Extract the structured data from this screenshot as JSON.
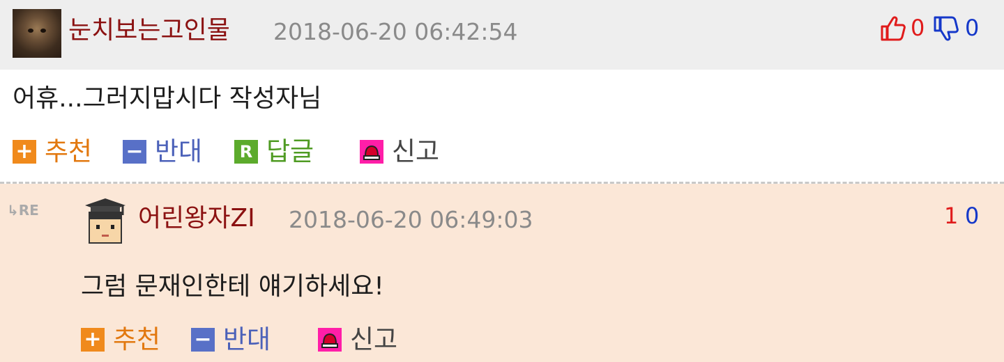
{
  "comment1": {
    "nickname": "눈치보는고인물",
    "date": "2018-06-20 06:42:54",
    "upvotes": "0",
    "downvotes": "0",
    "text": "어휴...그러지맙시다 작성자님",
    "actions": {
      "recommend": "추천",
      "oppose": "반대",
      "reply": "답글",
      "report": "신고"
    }
  },
  "comment2": {
    "reply_marker": "RE",
    "nickname": "어린왕자ZI",
    "date": "2018-06-20 06:49:03",
    "upvotes": "1",
    "downvotes": "0",
    "text": "그럼 문재인한테 얘기하세요!",
    "actions": {
      "recommend": "추천",
      "oppose": "반대",
      "report": "신고"
    }
  },
  "icons": {
    "recommend": "plus-icon",
    "oppose": "minus-icon",
    "reply": "reply-r-icon",
    "report": "siren-icon",
    "upvote": "thumbs-up-icon",
    "downvote": "thumbs-down-icon"
  },
  "colors": {
    "nickname": "#8b1111",
    "upvote": "#e01b1b",
    "downvote": "#1538c9",
    "recommend": "#f08a1c",
    "oppose": "#5870c7",
    "reply": "#5cab2c",
    "report": "#ff1ea8",
    "reply_background": "#fbe7d7",
    "header_background": "#eeeeee"
  }
}
